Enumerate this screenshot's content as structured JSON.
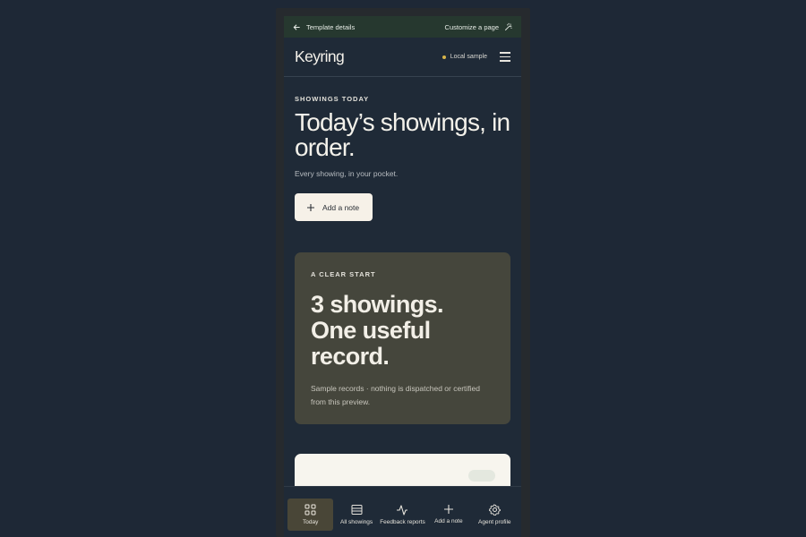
{
  "topbar": {
    "back_label": "Template details",
    "customize_label": "Customize a page"
  },
  "app": {
    "brand": "Keyring",
    "status": "Local sample",
    "accent": "#d8b54a"
  },
  "hero": {
    "eyebrow": "SHOWINGS TODAY",
    "title": "Today’s showings, in order.",
    "subtitle": "Every showing, in your pocket.",
    "button_label": "Add a note"
  },
  "summary": {
    "eyebrow": "A CLEAR START",
    "title": "3 showings. One useful record.",
    "note": "Sample records · nothing is dispatched or certified from this preview."
  },
  "nav": {
    "items": [
      {
        "label": "Today",
        "icon": "grid-icon"
      },
      {
        "label": "All showings",
        "icon": "list-icon"
      },
      {
        "label": "Feedback reports",
        "icon": "activity-icon"
      },
      {
        "label": "Add a note",
        "icon": "plus-icon"
      },
      {
        "label": "Agent profile",
        "icon": "gear-icon"
      }
    ]
  }
}
